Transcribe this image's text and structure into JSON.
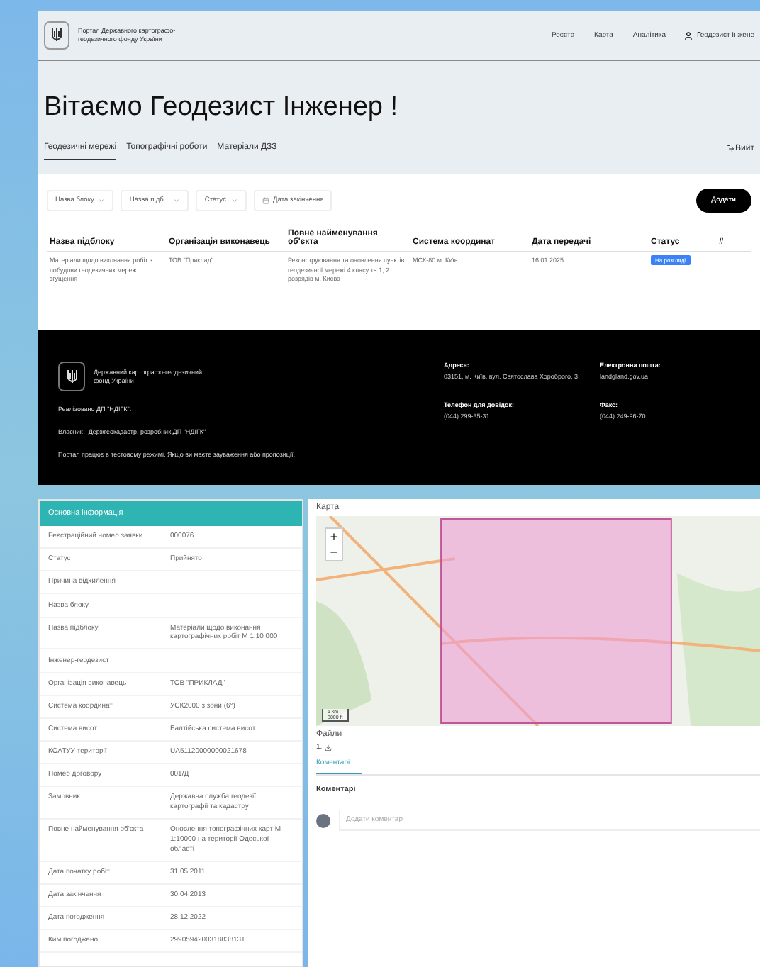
{
  "portal": {
    "header": {
      "logo_text": "Портал Державного картографо-геодезичного фонду України",
      "nav": [
        "Реєстр",
        "Карта",
        "Аналітика"
      ],
      "user": "Геодезист Інжене"
    },
    "title": "Вітаємо Геодезист Інженер !",
    "tabs": [
      {
        "label": "Геодезичні мережі",
        "selected": true
      },
      {
        "label": "Топографічні роботи",
        "selected": false
      },
      {
        "label": "Матеріали ДЗЗ",
        "selected": false
      }
    ],
    "logout": "Вийт",
    "filters": [
      {
        "kind": "select",
        "label": "Назва блоку"
      },
      {
        "kind": "select",
        "label": "Назва підб..."
      },
      {
        "kind": "select",
        "label": "Статус"
      },
      {
        "kind": "date",
        "label": "Дата закінчення"
      }
    ],
    "add_button": "Додати",
    "table": {
      "columns": [
        "Назва підблоку",
        "Організація виконавець",
        "Повне найменування об'єкта",
        "Система координат",
        "Дата передачі",
        "Статус",
        "#"
      ],
      "rows": [
        {
          "cells": [
            "Матеріали щодо виконання робіт з побудови геодезичних мереж згущення",
            "ТОВ \"Приклад\"",
            "Реконструювання та оновлення пунктів геодезичної мережі 4 класу та 1, 2 розрядів м. Києва",
            "МСК-80 м. Київ",
            "16.01.2025"
          ],
          "status": "На розгляді"
        }
      ]
    },
    "footer": {
      "logo_text": "Державний картографо-геодезичний фонд України",
      "lines": [
        "Реалізовано ДП \"НДІГК\".",
        "Власник - Держгеокадастр, розробник ДП \"НДІГК\"",
        "Портал працює в тестовому режимі. Якщо ви маєте зауваження або пропозиції,"
      ],
      "contacts": [
        {
          "label": "Адреса:",
          "value": "03151, м. Київ, вул. Святослава Хороброго, 3"
        },
        {
          "label": "Електронна пошта:",
          "value": "landgland.gov.ua"
        },
        {
          "label": "Телефон для довідок:",
          "value": "(044) 299-35-31"
        },
        {
          "label": "Факс:",
          "value": "(044) 249-96-70"
        }
      ]
    }
  },
  "details": {
    "info": {
      "title": "Основна інформація",
      "rows": [
        {
          "label": "Реєстраційний номер заявки",
          "value": "000076"
        },
        {
          "label": "Статус",
          "value": "Прийнято"
        },
        {
          "label": "Причина відхилення"
        },
        {
          "label": "Назва блоку"
        },
        {
          "label": "Назва підблоку",
          "value": "Матеріали щодо виконання картографічних робіт М 1:10 000"
        },
        {
          "label": "Інженер-геодезист"
        },
        {
          "label": "Організація виконавець",
          "value": "ТОВ \"ПРИКЛАД\""
        },
        {
          "label": "Система координат",
          "value": "УСК2000 з зони (6°)"
        },
        {
          "label": "Система висот",
          "value": "Балтійська система висот"
        },
        {
          "label": "КОАТУУ території",
          "value": "UA51120000000021678"
        },
        {
          "label": "Номер договору",
          "value": "001/Д"
        },
        {
          "label": "Замовник",
          "value": "Державна служба геодезії, картографії та кадастру"
        },
        {
          "label": "Повне найменування об'єкта",
          "value": "Оновлення топографічних карт М 1:10000 на території Одеської області"
        },
        {
          "label": "Дата початку робіт",
          "value": "31.05.2011"
        },
        {
          "label": "Дата закінчення",
          "value": "30.04.2013"
        },
        {
          "label": "Дата погодження",
          "value": "28.12.2022"
        },
        {
          "label": "Ким погоджено",
          "value": "2990594200318838131"
        }
      ]
    },
    "map": {
      "title": "Карта",
      "scale": [
        "1 km",
        "3000 ft"
      ]
    },
    "files": {
      "title": "Файли",
      "items": [
        "1."
      ]
    },
    "comment_tabs": [
      {
        "label": "Коментарі",
        "selected": true
      }
    ],
    "comments": {
      "title": "Коментарі",
      "placeholder": "Додати коментар"
    }
  }
}
